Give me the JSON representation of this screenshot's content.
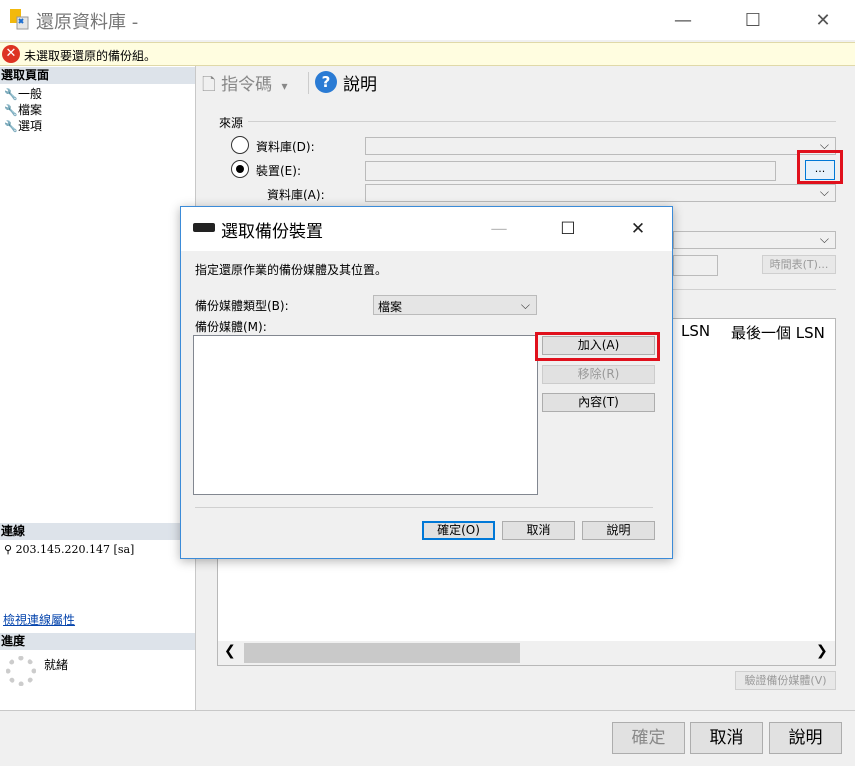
{
  "window": {
    "title": "還原資料庫 -",
    "minimize": "—",
    "maximize": "☐",
    "close": "✕"
  },
  "error_bar": {
    "icon": "error-icon",
    "message": "未選取要還原的備份組。"
  },
  "sidebar": {
    "select_page_header": "選取頁面",
    "pages": [
      {
        "label": "一般"
      },
      {
        "label": "檔案"
      },
      {
        "label": "選項"
      }
    ],
    "connection_header": "連線",
    "connection_server": "203.145.220.147 [sa]",
    "view_connection_link": "檢視連線屬性",
    "progress_header": "進度",
    "progress_status": "就緒"
  },
  "toolbar": {
    "script_label": "指令碼",
    "script_dropdown": "▾",
    "help_label": "說明"
  },
  "source": {
    "section_label": "來源",
    "database_radio": "資料庫(D):",
    "device_radio": "裝置(E):",
    "database_label": "資料庫(A):",
    "browse_button": "..."
  },
  "destination": {
    "timeline_button": "時間表(T)..."
  },
  "grid": {
    "columns": [
      "LSN",
      "最後一個 LSN"
    ]
  },
  "verify_button": "驗證備份媒體(V)",
  "footer": {
    "ok": "確定",
    "cancel": "取消",
    "help": "說明"
  },
  "dialog": {
    "title": "選取備份裝置",
    "description": "指定還原作業的備份媒體及其位置。",
    "media_type_label": "備份媒體類型(B):",
    "media_type_value": "檔案",
    "media_label": "備份媒體(M):",
    "add_button": "加入(A)",
    "remove_button": "移除(R)",
    "contents_button": "內容(T)",
    "ok_button": "確定(O)",
    "cancel_button": "取消",
    "help_button": "說明"
  },
  "colors": {
    "highlight": "#e0101c",
    "accent": "#0078d7",
    "error": "#d32f2f"
  }
}
